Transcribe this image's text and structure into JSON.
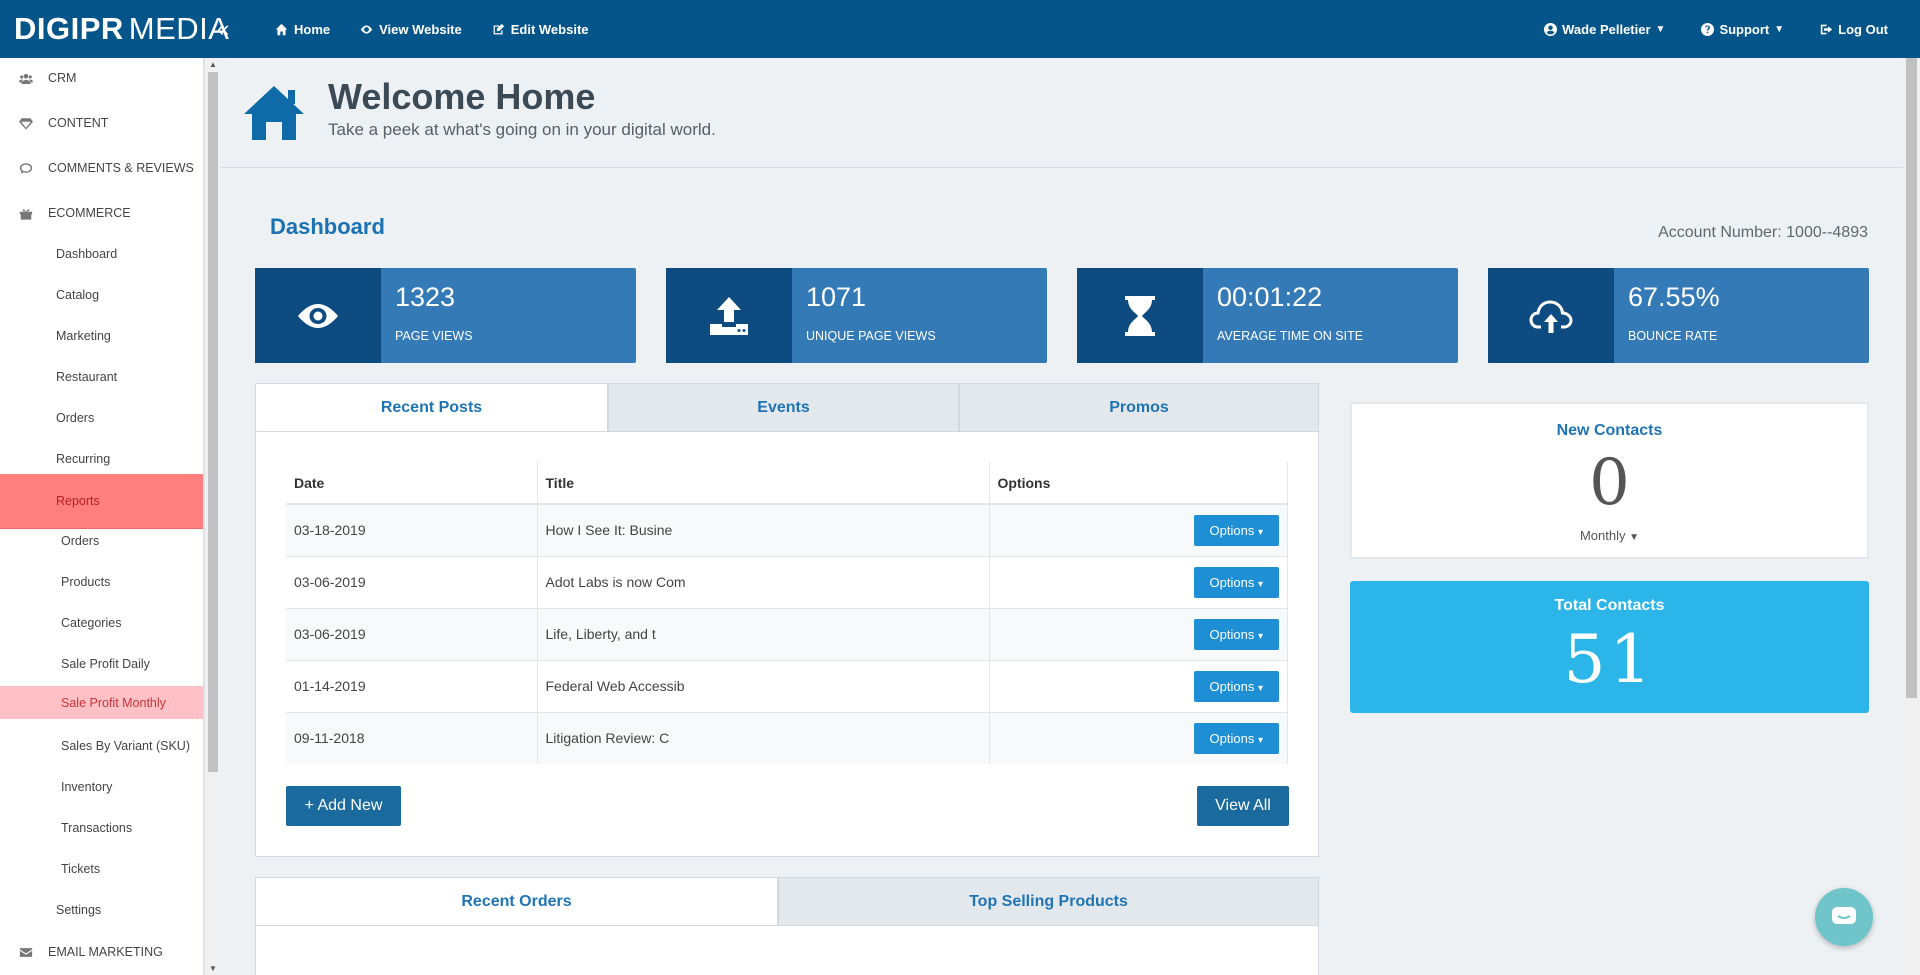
{
  "brand": {
    "part1": "DIGIPR",
    "part2": "MEDIA"
  },
  "topnav": [
    {
      "label": "Home",
      "icon": "home-icon"
    },
    {
      "label": "View Website",
      "icon": "eye-icon"
    },
    {
      "label": "Edit Website",
      "icon": "edit-icon"
    }
  ],
  "topright": {
    "user": "Wade Pelletier",
    "support": "Support",
    "logout": "Log Out"
  },
  "sidebar": {
    "items": [
      {
        "label": "CRM",
        "icon": "users-icon"
      },
      {
        "label": "CONTENT",
        "icon": "diamond-icon"
      },
      {
        "label": "COMMENTS & REVIEWS",
        "icon": "comment-icon"
      },
      {
        "label": "ECOMMERCE",
        "icon": "gift-icon"
      },
      {
        "label": "Dashboard"
      },
      {
        "label": "Catalog"
      },
      {
        "label": "Marketing"
      },
      {
        "label": "Restaurant"
      },
      {
        "label": "Orders"
      },
      {
        "label": "Recurring"
      },
      {
        "label": "Reports"
      },
      {
        "label": "Orders"
      },
      {
        "label": "Products"
      },
      {
        "label": "Categories"
      },
      {
        "label": "Sale Profit Daily"
      },
      {
        "label": "Sale Profit Monthly"
      },
      {
        "label": "Sales By Variant (SKU)"
      },
      {
        "label": "Inventory"
      },
      {
        "label": "Transactions"
      },
      {
        "label": "Tickets"
      },
      {
        "label": "Settings"
      },
      {
        "label": "EMAIL MARKETING",
        "icon": "envelope-icon"
      }
    ]
  },
  "header": {
    "title": "Welcome Home",
    "subtitle": "Take a peek at what's going on in your digital world."
  },
  "dashboard": {
    "title": "Dashboard",
    "account": "Account Number: 1000--4893"
  },
  "stats": [
    {
      "value": "1323",
      "label": "PAGE VIEWS",
      "icon": "eye-icon"
    },
    {
      "value": "1071",
      "label": "UNIQUE PAGE VIEWS",
      "icon": "upload-icon"
    },
    {
      "value": "00:01:22",
      "label": "AVERAGE TIME ON SITE",
      "icon": "hourglass-icon"
    },
    {
      "value": "67.55%",
      "label": "BOUNCE RATE",
      "icon": "cloud-upload-icon"
    }
  ],
  "tabs": [
    "Recent Posts",
    "Events",
    "Promos"
  ],
  "posts": {
    "headers": [
      "Date",
      "Title",
      "Options"
    ],
    "rows": [
      {
        "date": "03-18-2019",
        "title": "How I See It: Busine",
        "option": "Options"
      },
      {
        "date": "03-06-2019",
        "title": "Adot Labs is now Com",
        "option": "Options"
      },
      {
        "date": "03-06-2019",
        "title": "Life, Liberty, and t",
        "option": "Options"
      },
      {
        "date": "01-14-2019",
        "title": "Federal Web Accessib",
        "option": "Options"
      },
      {
        "date": "09-11-2018",
        "title": "Litigation Review: C",
        "option": "Options"
      }
    ],
    "add_new": "+ Add New",
    "view_all": "View All"
  },
  "new_contacts": {
    "title": "New Contacts",
    "value": "0",
    "period": "Monthly"
  },
  "total_contacts": {
    "title": "Total Contacts",
    "value": "51"
  },
  "tabs2": [
    "Recent Orders",
    "Top Selling Products"
  ],
  "colors": {
    "topbar": "#06558a",
    "stat": "#337ab7",
    "stat_icon": "#0d4b80",
    "accent": "#1f74b4",
    "total": "#2bb5e8",
    "active": "#ff7f7f"
  }
}
